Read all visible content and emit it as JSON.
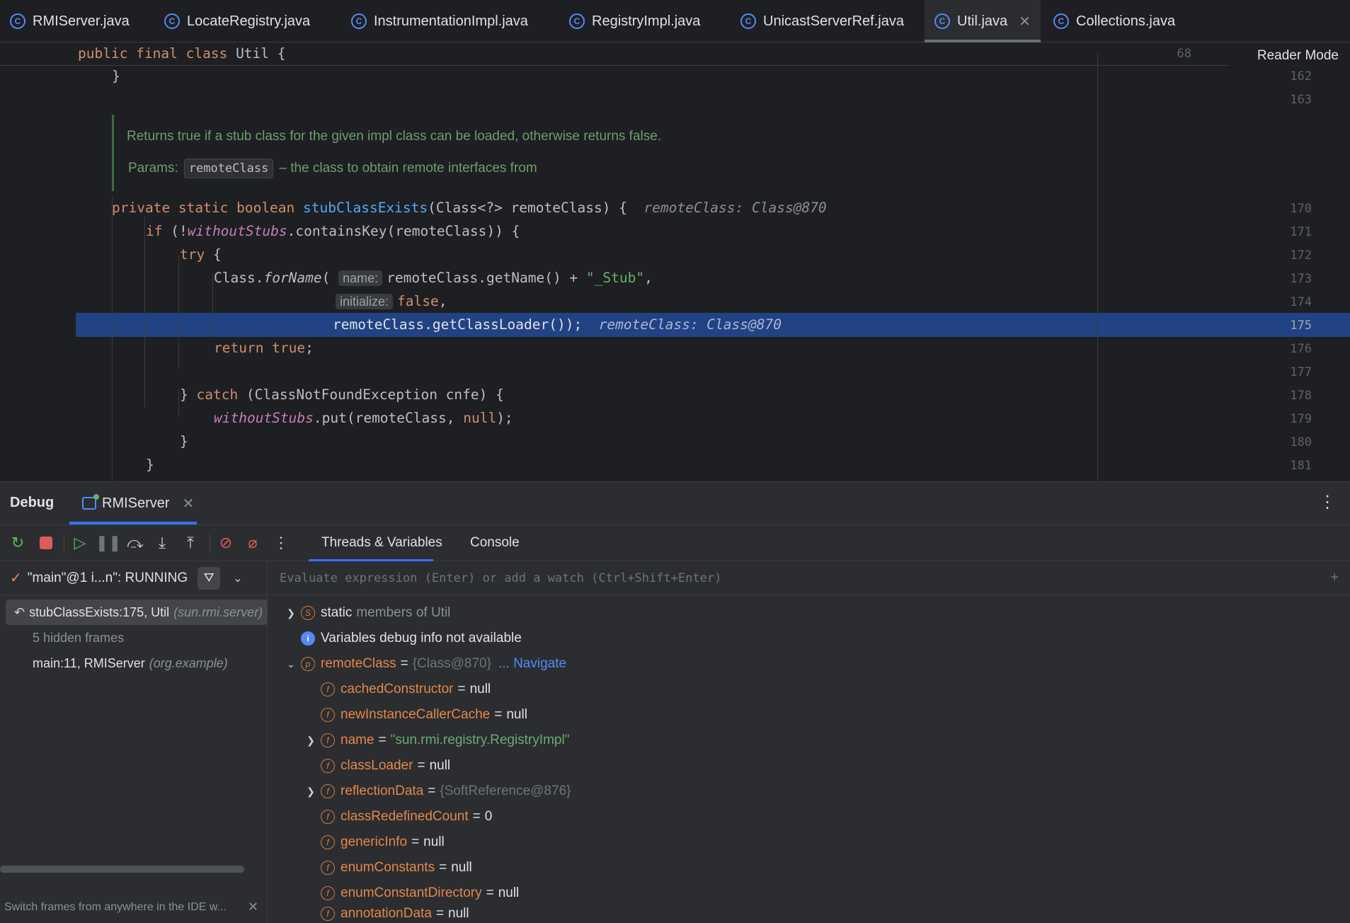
{
  "tabs": [
    {
      "label": "RMIServer.java",
      "active": false
    },
    {
      "label": "LocateRegistry.java",
      "active": false
    },
    {
      "label": "InstrumentationImpl.java",
      "active": false
    },
    {
      "label": "RegistryImpl.java",
      "active": false
    },
    {
      "label": "UnicastServerRef.java",
      "active": false
    },
    {
      "label": "Util.java",
      "active": true
    },
    {
      "label": "Collections.java",
      "active": false
    }
  ],
  "editor": {
    "reader_mode": "Reader Mode",
    "sticky_line_number": "68",
    "line_numbers": [
      "162",
      "163",
      "170",
      "171",
      "172",
      "173",
      "174",
      "175",
      "176",
      "177",
      "178",
      "179",
      "180",
      "181"
    ],
    "current_line": "175",
    "doc": {
      "summary": "Returns true if a stub class for the given impl class can be loaded, otherwise returns false.",
      "params_label": "Params:",
      "param_name": "remoteClass",
      "param_desc": "– the class to obtain remote interfaces from"
    },
    "inlay": {
      "line170": "remoteClass: Class@870",
      "line175": "remoteClass: Class@870",
      "name_hint": "name:",
      "initialize_hint": "initialize:"
    }
  },
  "debug": {
    "title": "Debug",
    "session_tab": "RMIServer",
    "subtabs": [
      "Threads & Variables",
      "Console"
    ],
    "thread": "\"main\"@1 i...n\": RUNNING",
    "frames": [
      {
        "label": "stubClassExists:175, Util",
        "pkg": "(sun.rmi.server)"
      },
      {
        "label": "5 hidden frames",
        "pkg": ""
      },
      {
        "label": "main:11, RMIServer",
        "pkg": "(org.example)"
      }
    ],
    "switch_tip": "Switch frames from anywhere in the IDE w...",
    "eval_placeholder": "Evaluate expression (Enter) or add a watch (Ctrl+Shift+Enter)",
    "variables": {
      "static_kw": "static",
      "static_rest": "members of Util",
      "info": "Variables debug info not available",
      "remote_name": "remoteClass",
      "remote_value": "{Class@870}",
      "navigate": "... Navigate",
      "fields": [
        {
          "name": "cachedConstructor",
          "value": "null"
        },
        {
          "name": "newInstanceCallerCache",
          "value": "null"
        },
        {
          "name": "name",
          "value": "\"sun.rmi.registry.RegistryImpl\""
        },
        {
          "name": "classLoader",
          "value": "null"
        },
        {
          "name": "reflectionData",
          "value": "{SoftReference@876}"
        },
        {
          "name": "classRedefinedCount",
          "value": "0"
        },
        {
          "name": "genericInfo",
          "value": "null"
        },
        {
          "name": "enumConstants",
          "value": "null"
        },
        {
          "name": "enumConstantDirectory",
          "value": "null"
        },
        {
          "name": "annotationData",
          "value": "null"
        }
      ]
    }
  }
}
